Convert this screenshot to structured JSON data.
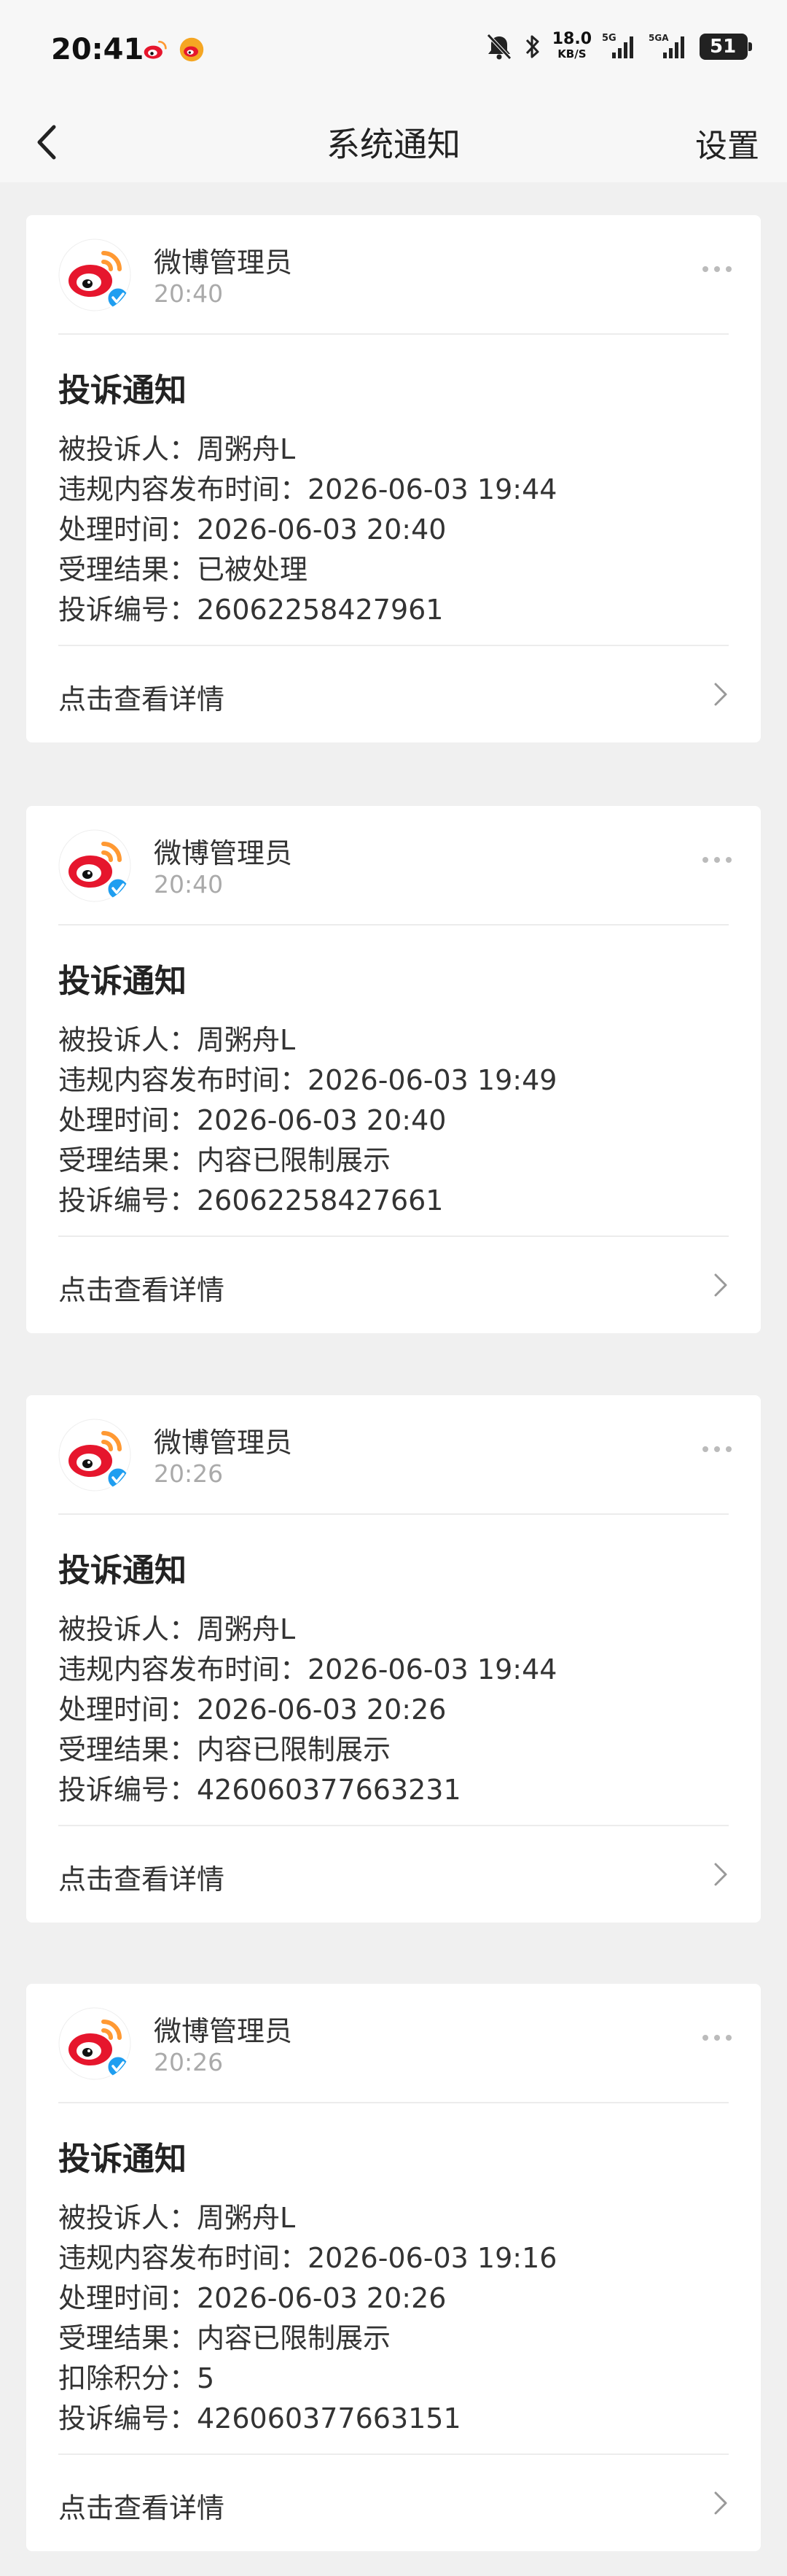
{
  "status_bar": {
    "time": "20:41",
    "net_speed": "18.0",
    "net_unit": "KB/S",
    "battery": "51",
    "icons": [
      "weibo-icon",
      "weibo-icon",
      "mute-bell-icon",
      "bluetooth-icon",
      "signal-5g-icon",
      "signal-5ga-icon",
      "battery-icon"
    ]
  },
  "nav": {
    "title": "系统通知",
    "settings_label": "设置"
  },
  "colors": {
    "weibo_red": "#e6162d",
    "weibo_orange": "#ff9933",
    "verified_blue": "#1f9ef0"
  },
  "cards": [
    {
      "sender": "微博管理员",
      "time": "20:40",
      "title": "投诉通知",
      "lines": [
        "被投诉人：周粥舟L",
        "违规内容发布时间：2026-06-03 19:44",
        "处理时间：2026-06-03 20:40",
        "受理结果：已被处理",
        "投诉编号：26062258427961"
      ],
      "detail_label": "点击查看详情"
    },
    {
      "sender": "微博管理员",
      "time": "20:40",
      "title": "投诉通知",
      "lines": [
        "被投诉人：周粥舟L",
        "违规内容发布时间：2026-06-03 19:49",
        "处理时间：2026-06-03 20:40",
        "受理结果：内容已限制展示",
        "投诉编号：26062258427661"
      ],
      "detail_label": "点击查看详情"
    },
    {
      "sender": "微博管理员",
      "time": "20:26",
      "title": "投诉通知",
      "lines": [
        "被投诉人：周粥舟L",
        "违规内容发布时间：2026-06-03 19:44",
        "处理时间：2026-06-03 20:26",
        "受理结果：内容已限制展示",
        "投诉编号：426060377663231"
      ],
      "detail_label": "点击查看详情"
    },
    {
      "sender": "微博管理员",
      "time": "20:26",
      "title": "投诉通知",
      "lines": [
        "被投诉人：周粥舟L",
        "违规内容发布时间：2026-06-03 19:16",
        "处理时间：2026-06-03 20:26",
        "受理结果：内容已限制展示",
        "扣除积分：5",
        "投诉编号：426060377663151"
      ],
      "detail_label": "点击查看详情"
    }
  ]
}
